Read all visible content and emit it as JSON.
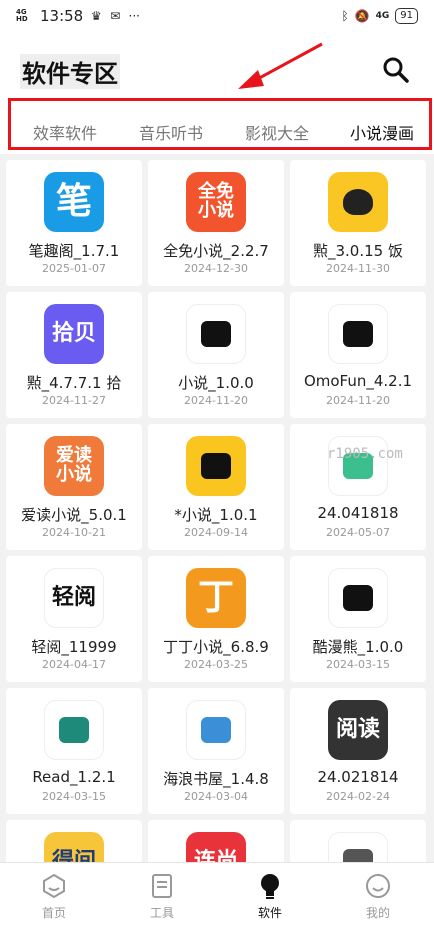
{
  "status_bar": {
    "network": "4G HD",
    "time": "13:58",
    "signal": "4G",
    "battery": "91"
  },
  "header": {
    "title": "软件专区"
  },
  "tabs": [
    {
      "label": "效率软件",
      "active": false
    },
    {
      "label": "音乐听书",
      "active": false
    },
    {
      "label": "影视大全",
      "active": false
    },
    {
      "label": "小说漫画",
      "active": true
    }
  ],
  "watermark": "r1905.com",
  "apps": [
    {
      "name": "笔趣阁_1.7.1",
      "date": "2025-01-07",
      "icon": "biquge-icon",
      "icon_text": "笔",
      "bg": "#1a9be6",
      "fg": "#ffffff"
    },
    {
      "name": "全免小说_2.2.7",
      "date": "2024-12-30",
      "icon": "quanmian-icon",
      "icon_text": "全免小说",
      "bg": "#f2542d",
      "fg": "#ffffff"
    },
    {
      "name": "㸃_3.0.15   饭",
      "date": "2024-11-30",
      "icon": "fantuan-icon",
      "icon_text": "",
      "bg": "#f9c623",
      "fg": "#222222"
    },
    {
      "name": "㸃_4.7.7.1   拾",
      "date": "2024-11-27",
      "icon": "shibei-icon",
      "icon_text": "拾贝",
      "bg": "#6a5cf0",
      "fg": "#ffffff"
    },
    {
      "name": "小说_1.0.0",
      "date": "2024-11-20",
      "icon": "black-cat-icon",
      "icon_text": "",
      "bg": "#ffffff",
      "fg": "#111111"
    },
    {
      "name": "OmoFun_4.2.1",
      "date": "2024-11-20",
      "icon": "black-cat-icon",
      "icon_text": "",
      "bg": "#ffffff",
      "fg": "#111111"
    },
    {
      "name": "爱读小说_5.0.1",
      "date": "2024-10-21",
      "icon": "aidu-icon",
      "icon_text": "爱读小说",
      "bg": "#f07a3a",
      "fg": "#ffffff"
    },
    {
      "name": "*小说_1.0.1",
      "date": "2024-09-14",
      "icon": "yellow-cat-icon",
      "icon_text": "",
      "bg": "#fbc520",
      "fg": "#111111"
    },
    {
      "name": "24.041818",
      "date": "2024-05-07",
      "icon": "open-book-icon",
      "icon_text": "",
      "bg": "#ffffff",
      "fg": "#3cbf8e"
    },
    {
      "name": "轻阅_11999",
      "date": "2024-04-17",
      "icon": "qingyue-icon",
      "icon_text": "轻阅",
      "bg": "#ffffff",
      "fg": "#111111"
    },
    {
      "name": "丁丁小说_6.8.9",
      "date": "2024-03-25",
      "icon": "dingding-icon",
      "icon_text": "丁",
      "bg": "#f39a1e",
      "fg": "#ffffff"
    },
    {
      "name": "酷漫熊_1.0.0",
      "date": "2024-03-15",
      "icon": "kumanxiong-icon",
      "icon_text": "",
      "bg": "#ffffff",
      "fg": "#111111"
    },
    {
      "name": "Read_1.2.1",
      "date": "2024-03-15",
      "icon": "teal-book-icon",
      "icon_text": "",
      "bg": "#ffffff",
      "fg": "#1e8a79"
    },
    {
      "name": "海浪书屋_1.4.8",
      "date": "2024-03-04",
      "icon": "hailang-icon",
      "icon_text": "",
      "bg": "#ffffff",
      "fg": "#3a8fd6"
    },
    {
      "name": "24.021814",
      "date": "2024-02-24",
      "icon": "yuedu-icon",
      "icon_text": "阅读",
      "bg": "#333333",
      "fg": "#ffffff"
    },
    {
      "name": "",
      "date": "",
      "icon": "dejian-icon",
      "icon_text": "得间",
      "bg": "#f7c53a",
      "fg": "#1f3c7a"
    },
    {
      "name": "",
      "date": "",
      "icon": "lianshang-icon",
      "icon_text": "连尚",
      "bg": "#e8333a",
      "fg": "#ffffff"
    },
    {
      "name": "",
      "date": "",
      "icon": "quill-icon",
      "icon_text": "",
      "bg": "#ffffff",
      "fg": "#555555"
    }
  ],
  "bottom_nav": [
    {
      "label": "首页",
      "icon": "home-hexagon-icon",
      "active": false
    },
    {
      "label": "工具",
      "icon": "tools-doc-icon",
      "active": false
    },
    {
      "label": "软件",
      "icon": "bulb-icon",
      "active": true
    },
    {
      "label": "我的",
      "icon": "smile-icon",
      "active": false
    }
  ],
  "colors": {
    "highlight_frame": "#e8141b",
    "arrow": "#e8141b",
    "active_text": "#111111",
    "inactive_text": "#777777"
  }
}
